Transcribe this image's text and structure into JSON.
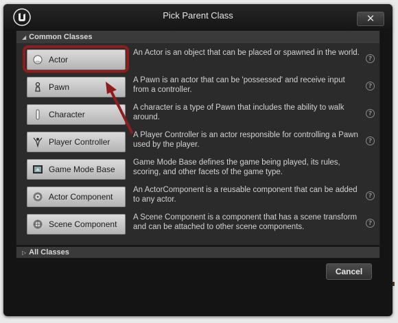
{
  "window": {
    "title": "Pick Parent Class",
    "close_symbol": "✕"
  },
  "common_section": {
    "toggle": "◢",
    "label": "Common Classes"
  },
  "classes": [
    {
      "label": "Actor",
      "icon": "actor-icon",
      "description": "An Actor is an object that can be placed or spawned in the world.",
      "help": "?"
    },
    {
      "label": "Pawn",
      "icon": "pawn-icon",
      "description": "A Pawn is an actor that can be 'possessed' and receive input from a controller.",
      "help": "?"
    },
    {
      "label": "Character",
      "icon": "character-icon",
      "description": "A character is a type of Pawn that includes the ability to walk around.",
      "help": "?"
    },
    {
      "label": "Player Controller",
      "icon": "player-controller-icon",
      "description": "A Player Controller is an actor responsible for controlling a Pawn used by the player.",
      "help": "?"
    },
    {
      "label": "Game Mode Base",
      "icon": "game-mode-icon",
      "description": "Game Mode Base defines the game being played, its rules, scoring, and other facets of the game type.",
      "help": "?"
    },
    {
      "label": "Actor Component",
      "icon": "actor-component-icon",
      "description": "An ActorComponent is a reusable component that can be added to any actor.",
      "help": "?"
    },
    {
      "label": "Scene Component",
      "icon": "scene-component-icon",
      "description": "A Scene Component is a component that has a scene transform and can be attached to other scene components.",
      "help": "?"
    }
  ],
  "all_classes_section": {
    "toggle": "▷",
    "label": "All Classes"
  },
  "cancel_label": "Cancel",
  "colors": {
    "highlight": "#8e1d1b",
    "dialog_bg": "#141414",
    "panel_bg": "#2b2b2b"
  }
}
